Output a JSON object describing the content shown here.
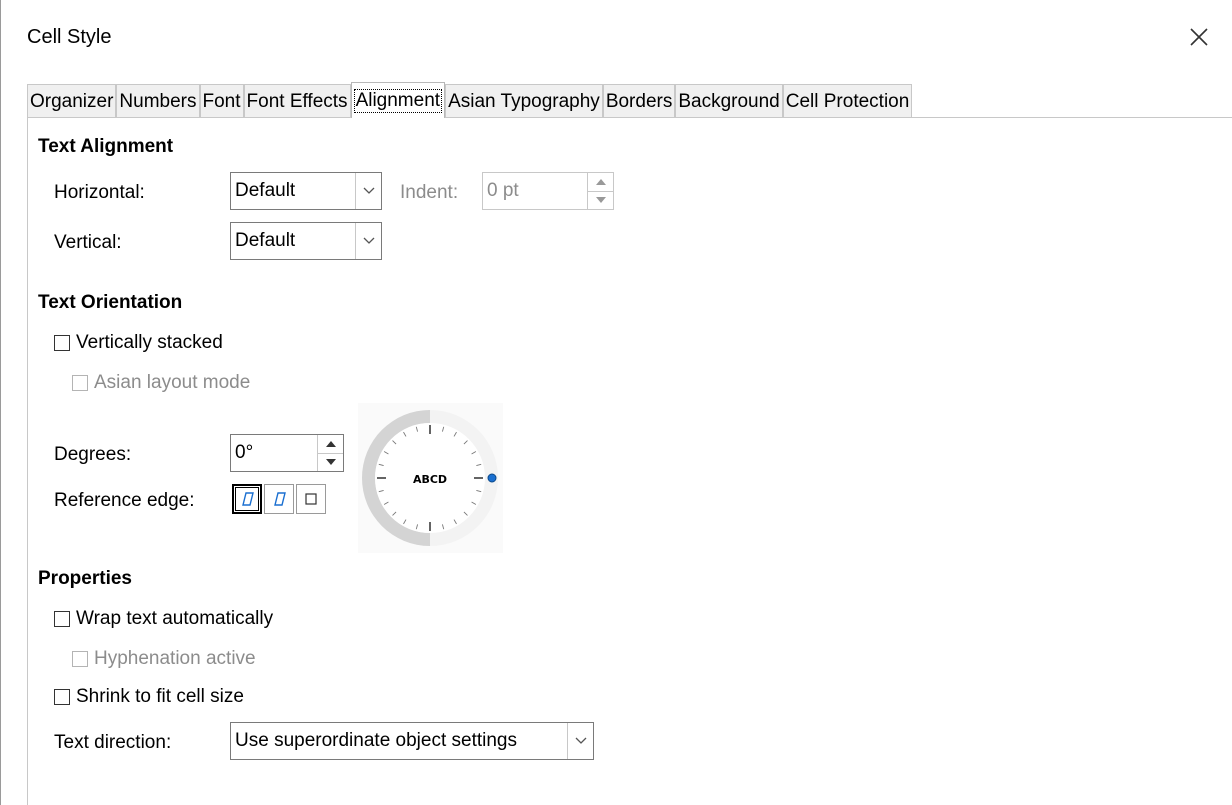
{
  "window": {
    "title": "Cell Style"
  },
  "tabs": [
    {
      "label": "Organizer"
    },
    {
      "label": "Numbers"
    },
    {
      "label": "Font"
    },
    {
      "label": "Font Effects"
    },
    {
      "label": "Alignment",
      "active": true
    },
    {
      "label": "Asian Typography"
    },
    {
      "label": "Borders"
    },
    {
      "label": "Background"
    },
    {
      "label": "Cell Protection"
    }
  ],
  "text_alignment": {
    "title": "Text Alignment",
    "horizontal_label": "Horizontal:",
    "horizontal_value": "Default",
    "indent_label": "Indent:",
    "indent_value": "0 pt",
    "vertical_label": "Vertical:",
    "vertical_value": "Default"
  },
  "text_orientation": {
    "title": "Text Orientation",
    "vertically_stacked": "Vertically stacked",
    "asian_layout_mode": "Asian layout mode",
    "degrees_label": "Degrees:",
    "degrees_value": "0°",
    "reference_edge_label": "Reference edge:",
    "dial_text": "ABCD"
  },
  "properties": {
    "title": "Properties",
    "wrap_text": "Wrap text automatically",
    "hyphenation": "Hyphenation active",
    "shrink": "Shrink to fit cell size",
    "text_direction_label": "Text direction:",
    "text_direction_value": "Use superordinate object settings"
  },
  "colors": {
    "accent": "#1a6fd0",
    "disabled": "#8c8c8c"
  }
}
